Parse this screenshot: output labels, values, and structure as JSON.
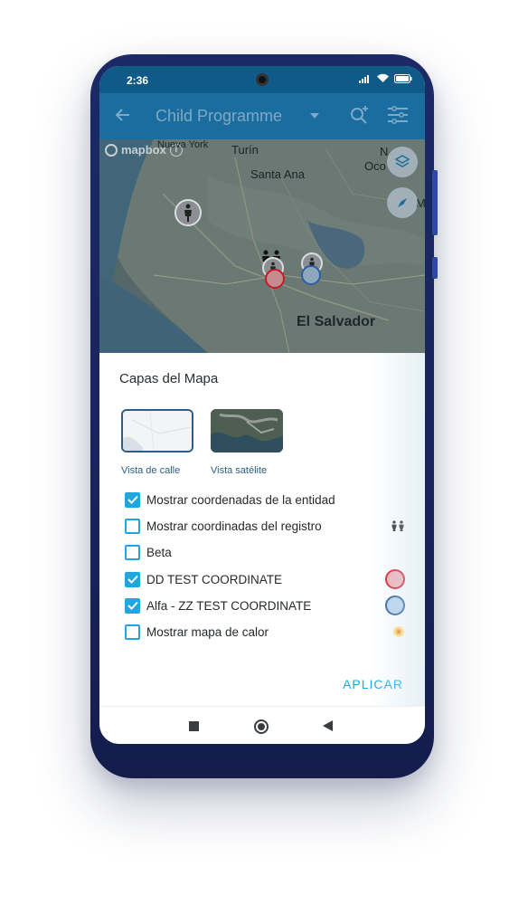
{
  "status_bar": {
    "time": "2:36"
  },
  "app_bar": {
    "title": "Child Programme",
    "icons": [
      "arrow-back-icon",
      "dropdown-arrow-icon",
      "search-add-icon",
      "filter-list-icon"
    ]
  },
  "map": {
    "attribution": "mapbox",
    "labels": [
      {
        "id": "nueva-york",
        "text": "Nueva York"
      },
      {
        "id": "turin",
        "text": "Turín"
      },
      {
        "id": "santa-ana",
        "text": "Santa Ana"
      },
      {
        "id": "n",
        "text": "N"
      },
      {
        "id": "oco",
        "text": "Oco"
      },
      {
        "id": "m",
        "text": "M"
      },
      {
        "id": "el-salvador",
        "text": "El Salvador"
      }
    ]
  },
  "layers_panel": {
    "title": "Capas del Mapa",
    "base_layers": [
      {
        "label": "Vista de calle",
        "selected": true
      },
      {
        "label": "Vista satélite",
        "selected": false
      }
    ],
    "options": [
      {
        "label": "Mostrar coordenadas de la entidad",
        "checked": true,
        "legend": ""
      },
      {
        "label": "Mostrar coordinadas del registro",
        "checked": false,
        "legend": "people-icon"
      },
      {
        "label": "Beta",
        "checked": false,
        "legend": ""
      },
      {
        "label": "DD TEST COORDINATE",
        "checked": true,
        "legend": "red-circle",
        "legend_fill": "#f0b3b8",
        "legend_stroke": "#d2202c"
      },
      {
        "label": "Alfa - ZZ TEST COORDINATE",
        "checked": true,
        "legend": "blue-circle",
        "legend_fill": "#b8d3ea",
        "legend_stroke": "#2b5f9e"
      },
      {
        "label": "Mostrar mapa de calor",
        "checked": false,
        "legend": "heatmap-icon"
      }
    ],
    "apply_label": "APLICAR"
  },
  "colors": {
    "app_bar": "#1a6e9f",
    "status_bar": "#0f5a86",
    "accent": "#1ea7e0",
    "phone_frame": "#1b2a66"
  }
}
